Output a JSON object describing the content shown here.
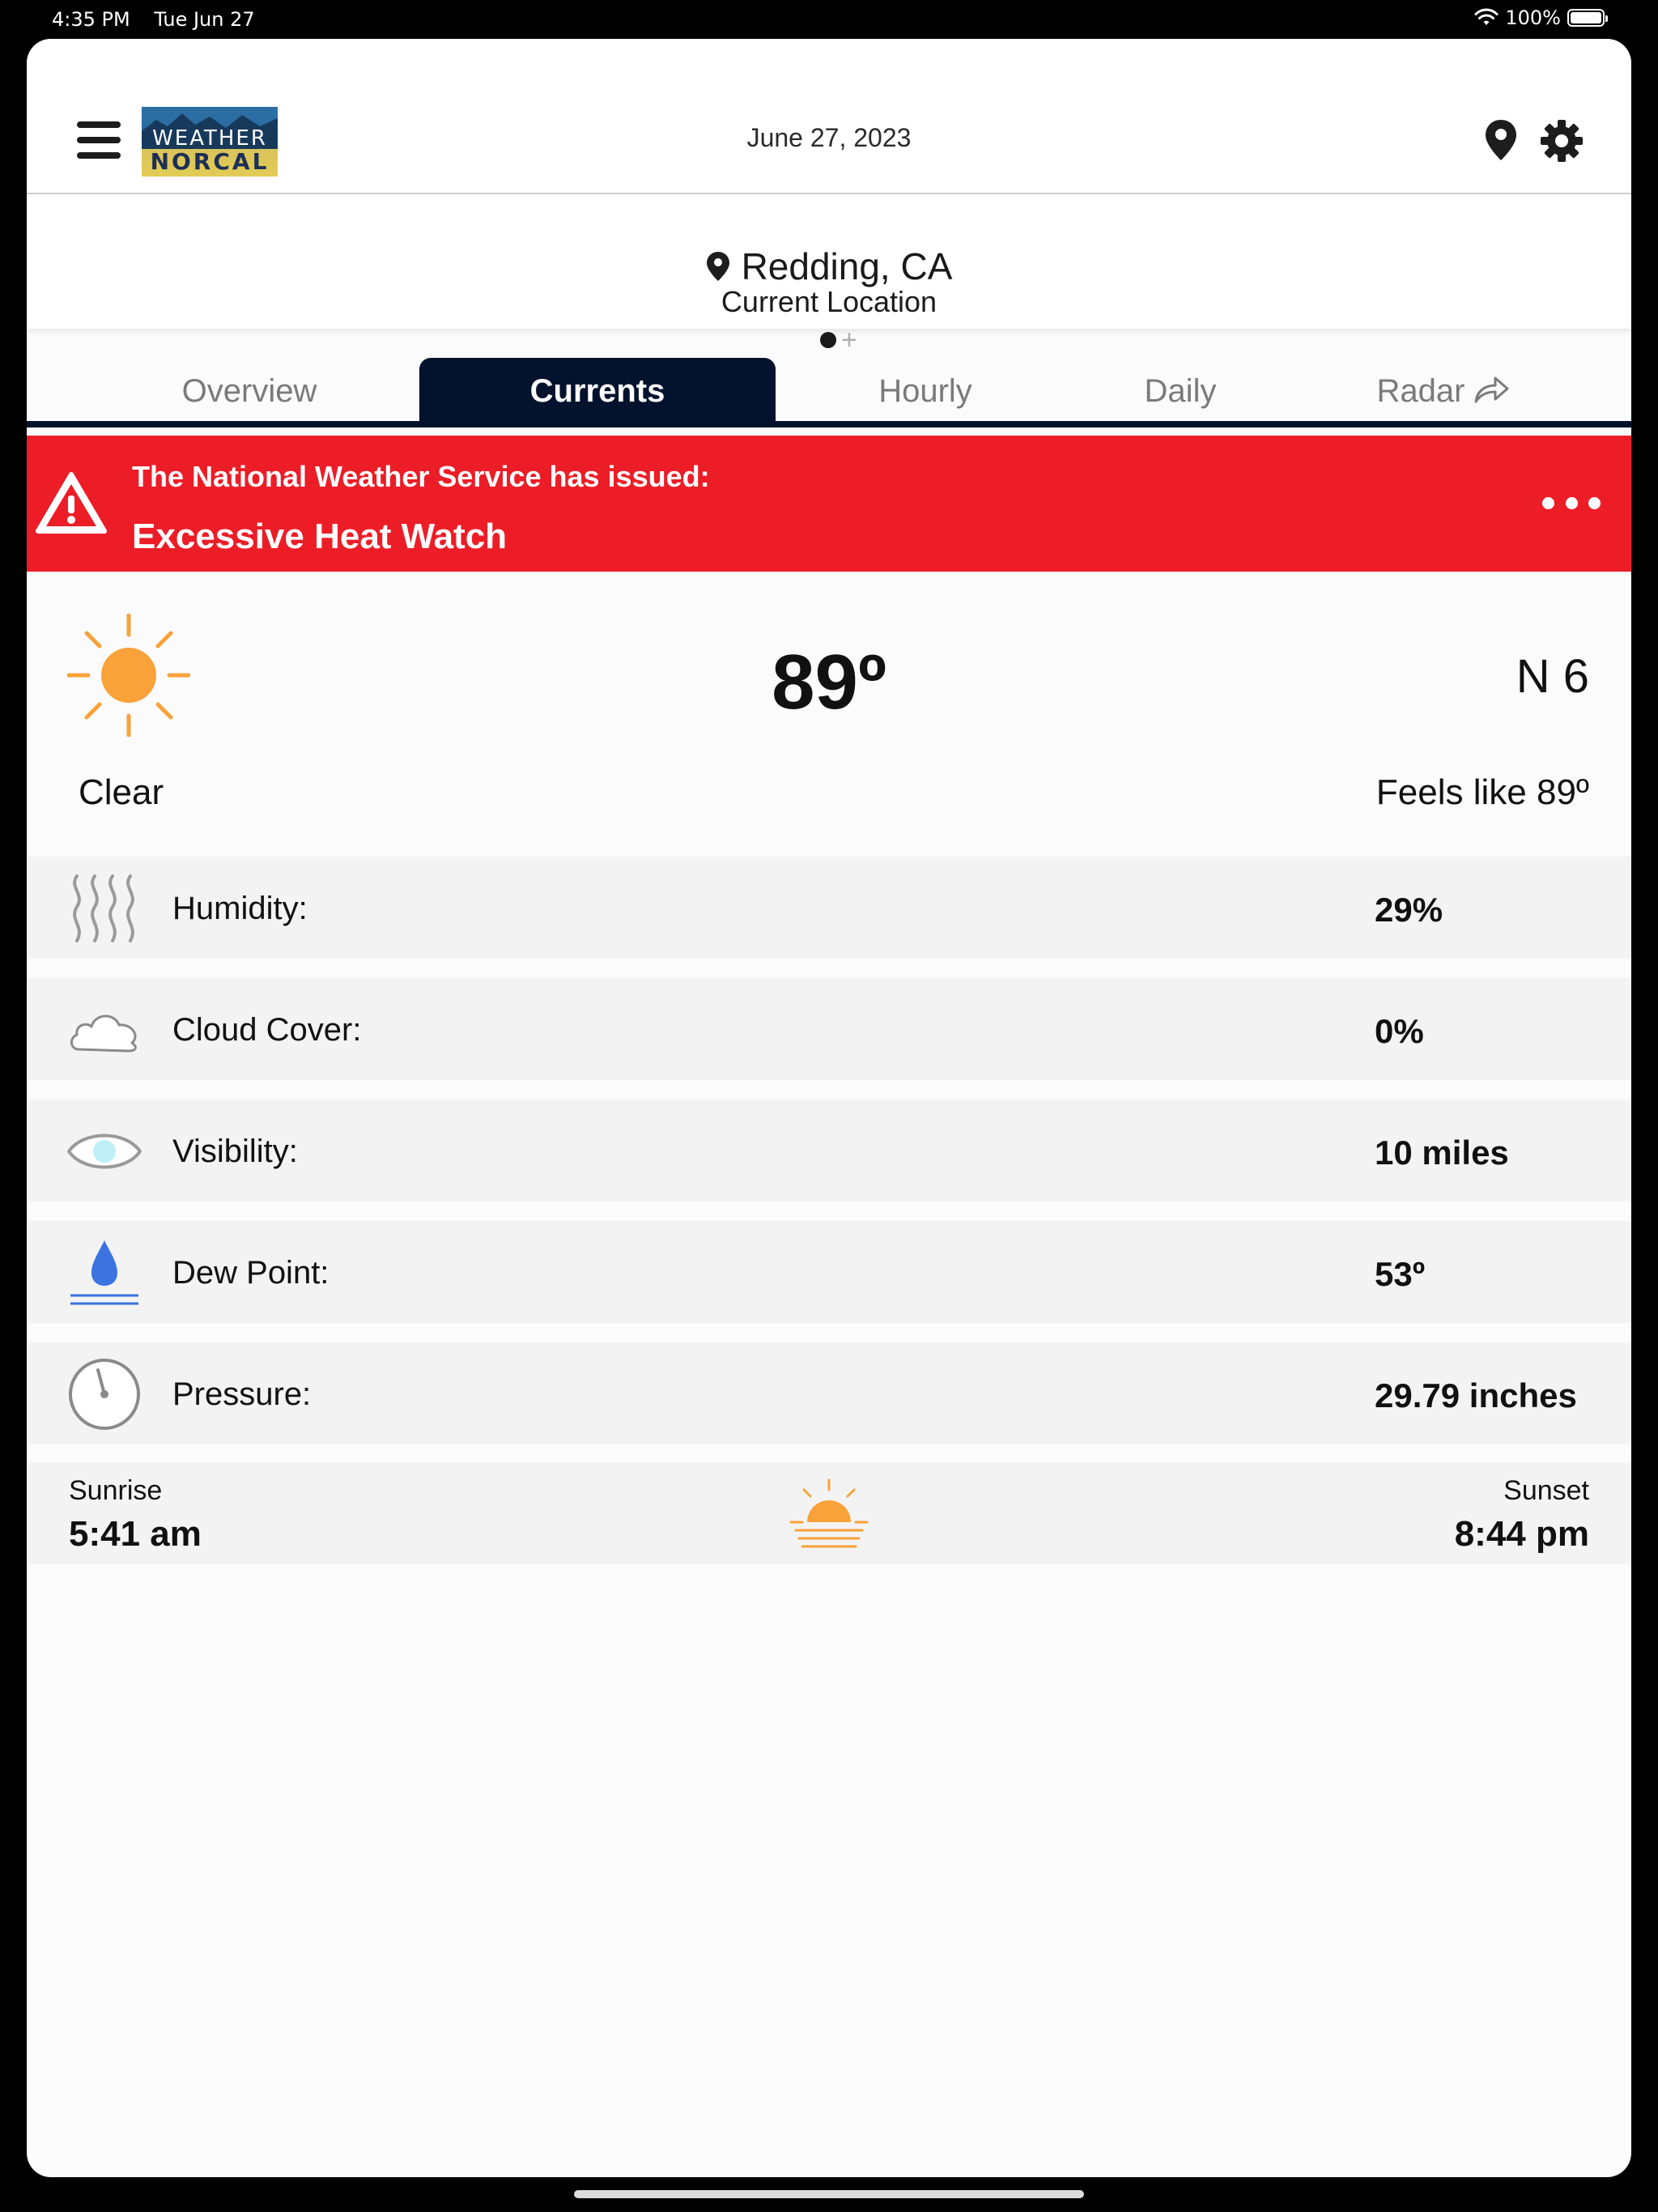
{
  "status_bar": {
    "time": "4:35 PM",
    "date": "Tue Jun 27",
    "battery": "100%",
    "battery_level": 1.0
  },
  "header": {
    "logo_line1": "WEATHER",
    "logo_line2": "NORCAL",
    "date": "June 27, 2023",
    "icons": [
      "menu-icon",
      "location-pin-icon",
      "gear-icon"
    ]
  },
  "location": {
    "name": "Redding, CA",
    "subtitle": "Current Location",
    "pager_plus": "+"
  },
  "tabs": [
    {
      "label": "Overview",
      "active": false
    },
    {
      "label": "Currents",
      "active": true
    },
    {
      "label": "Hourly",
      "active": false
    },
    {
      "label": "Daily",
      "active": false
    },
    {
      "label": "Radar",
      "active": false
    }
  ],
  "alert": {
    "line1": "The National Weather Service has issued:",
    "line2": "Excessive Heat Watch",
    "color": "#ec1d27"
  },
  "current": {
    "temperature": "89º",
    "wind": "N 6",
    "condition": "Clear",
    "feels_like": "Feels like 89º"
  },
  "details": [
    {
      "label": "Humidity:",
      "value": "29%",
      "icon": "humidity-icon"
    },
    {
      "label": "Cloud Cover:",
      "value": "0%",
      "icon": "cloud-icon"
    },
    {
      "label": "Visibility:",
      "value": "10 miles",
      "icon": "eye-icon"
    },
    {
      "label": "Dew Point:",
      "value": "53º",
      "icon": "water-drop-icon"
    },
    {
      "label": "Pressure:",
      "value": "29.79 inches",
      "icon": "gauge-icon"
    }
  ],
  "sun": {
    "sunrise_label": "Sunrise",
    "sunrise_time": "5:41 am",
    "sunset_label": "Sunset",
    "sunset_time": "8:44 pm"
  },
  "colors": {
    "nav_dark": "#03122d",
    "sun_orange": "#f9a23a",
    "drop_blue": "#3b73e0"
  }
}
